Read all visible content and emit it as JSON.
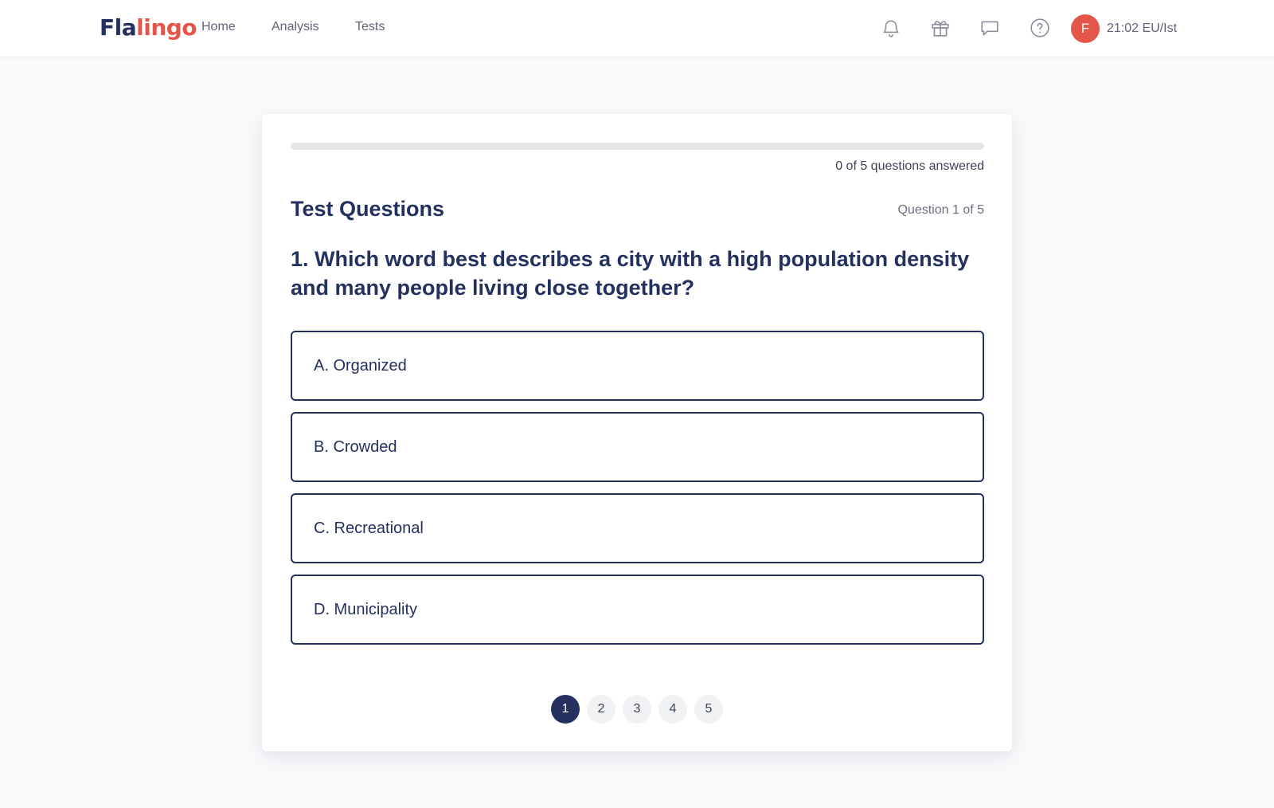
{
  "header": {
    "logo_part1": "Fla",
    "logo_part2": "lingo",
    "nav": [
      {
        "label": "Home"
      },
      {
        "label": "Analysis"
      },
      {
        "label": "Tests"
      }
    ],
    "icons": [
      "bell-icon",
      "gift-icon",
      "chat-icon",
      "help-icon"
    ],
    "avatar_initial": "F",
    "clock": "21:02 EU/Ist"
  },
  "progress": {
    "answered": 0,
    "total": 5,
    "fraction": 0,
    "label": "0 of 5 questions answered"
  },
  "test": {
    "title": "Test Questions",
    "counter": "Question 1 of 5",
    "question": "1. Which word best describes a city with a high population density and many people living close together?",
    "options": [
      {
        "label": "A. Organized"
      },
      {
        "label": "B. Crowded"
      },
      {
        "label": "C. Recreational"
      },
      {
        "label": "D. Municipality"
      }
    ]
  },
  "pagination": {
    "pages": [
      "1",
      "2",
      "3",
      "4",
      "5"
    ],
    "current": "1"
  },
  "colors": {
    "brand_navy": "#24305e",
    "brand_red": "#e4554a",
    "page_bg": "#f8f9fb"
  }
}
